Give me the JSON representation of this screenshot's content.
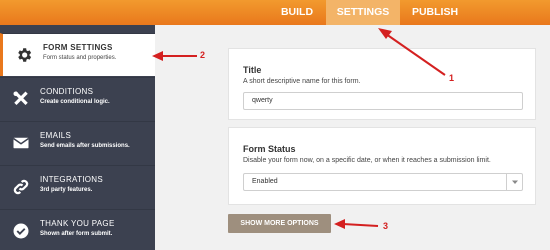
{
  "header": {
    "tabs": [
      "BUILD",
      "SETTINGS",
      "PUBLISH"
    ],
    "active_tab": "SETTINGS",
    "accent": "#e9781c"
  },
  "sidebar": {
    "items": [
      {
        "title": "FORM SETTINGS",
        "subtitle": "Form status and properties.",
        "icon": "gear-icon",
        "active": true
      },
      {
        "title": "CONDITIONS",
        "subtitle": "Create conditional logic.",
        "icon": "tools-icon",
        "active": false
      },
      {
        "title": "EMAILS",
        "subtitle": "Send emails after submissions.",
        "icon": "envelope-icon",
        "active": false
      },
      {
        "title": "INTEGRATIONS",
        "subtitle": "3rd party features.",
        "icon": "link-icon",
        "active": false
      },
      {
        "title": "THANK YOU PAGE",
        "subtitle": "Shown after form submit.",
        "icon": "check-circle-icon",
        "active": false
      }
    ]
  },
  "main": {
    "title_section": {
      "label": "Title",
      "description": "A short descriptive name for this form.",
      "value": "qwerty"
    },
    "status_section": {
      "label": "Form Status",
      "description": "Disable your form now, on a specific date, or when it reaches a submission limit.",
      "selected": "Enabled"
    },
    "more_button": "SHOW MORE OPTIONS"
  },
  "annotations": {
    "numbers": [
      "1",
      "2",
      "3"
    ],
    "color": "#d42020"
  }
}
